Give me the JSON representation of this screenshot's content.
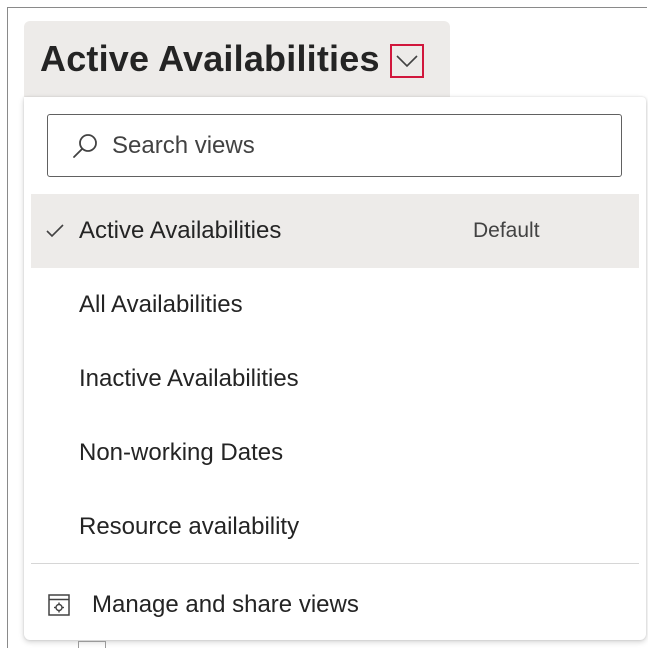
{
  "view_selector": {
    "title": "Active Availabilities",
    "chevron_icon": "chevron-down-icon",
    "highlight_color": "#d1173c"
  },
  "search": {
    "placeholder": "Search views",
    "value": "",
    "icon": "search-icon"
  },
  "views": [
    {
      "label": "Active Availabilities",
      "selected": true,
      "badge": "Default"
    },
    {
      "label": "All Availabilities",
      "selected": false
    },
    {
      "label": "Inactive Availabilities",
      "selected": false
    },
    {
      "label": "Non-working Dates",
      "selected": false
    },
    {
      "label": "Resource availability",
      "selected": false
    }
  ],
  "footer": {
    "manage_label": "Manage and share views",
    "manage_icon": "manage-views-icon"
  },
  "colors": {
    "selected_background": "#edebe9",
    "text": "#242424"
  }
}
